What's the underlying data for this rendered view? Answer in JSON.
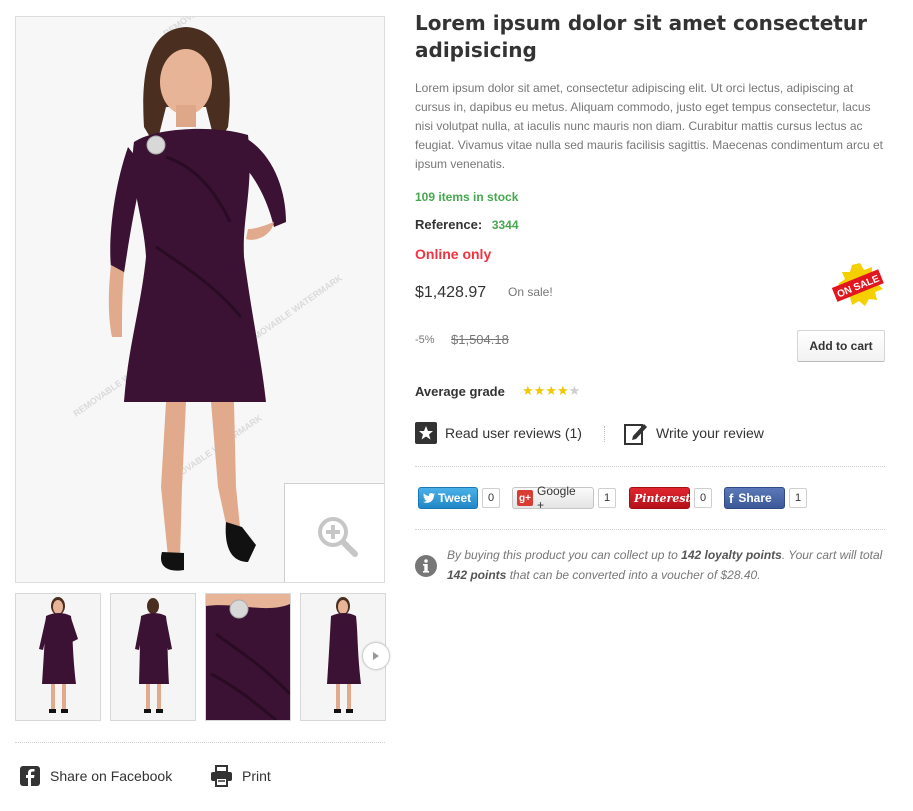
{
  "product": {
    "title": "Lorem ipsum dolor sit amet consectetur adipisicing",
    "description": "Lorem ipsum dolor sit amet, consectetur adipiscing elit. Ut orci lectus, adipiscing at cursus in, dapibus eu metus. Aliquam commodo, justo eget tempus consectetur, lacus nisi volutpat nulla, at iaculis nunc mauris non diam. Curabitur mattis cursus lectus ac feugiat. Vivamus vitae nulla sed mauris facilisis sagittis. Maecenas condimentum arcu et ipsum venenatis.",
    "stock": "109 items in stock",
    "reference_label": "Reference:",
    "reference_value": "3344",
    "online_only": "Online only",
    "price": "$1,428.97",
    "on_sale": "On sale!",
    "sale_badge": "ON SALE",
    "discount": "-5%",
    "old_price": "$1,504.18",
    "add_to_cart": "Add to cart"
  },
  "reviews": {
    "average_label": "Average grade",
    "rating": 4,
    "max_rating": 5,
    "read_reviews": "Read user reviews (1)",
    "write_review": "Write your review"
  },
  "sharing": {
    "tweet": "Tweet",
    "tweet_count": "0",
    "google": "Google +",
    "google_count": "1",
    "pinterest": "Pinterest",
    "pinterest_count": "0",
    "facebook": "Share",
    "facebook_count": "1"
  },
  "loyalty": {
    "prefix": "By buying this product you can collect up to ",
    "points": "142 loyalty points",
    "middle": ". Your cart will total ",
    "total_points": "142 points",
    "suffix": " that can be converted into a voucher of $28.40."
  },
  "gallery": {
    "watermark": "REMOVABLE WATERMARK",
    "thumbnail_count": 4
  },
  "footer_links": {
    "share_facebook": "Share on Facebook",
    "print": "Print"
  },
  "colors": {
    "stock_green": "#46a74e",
    "online_red": "#f13340",
    "dress_purple": "#3b1233",
    "star_yellow": "#efc800"
  }
}
